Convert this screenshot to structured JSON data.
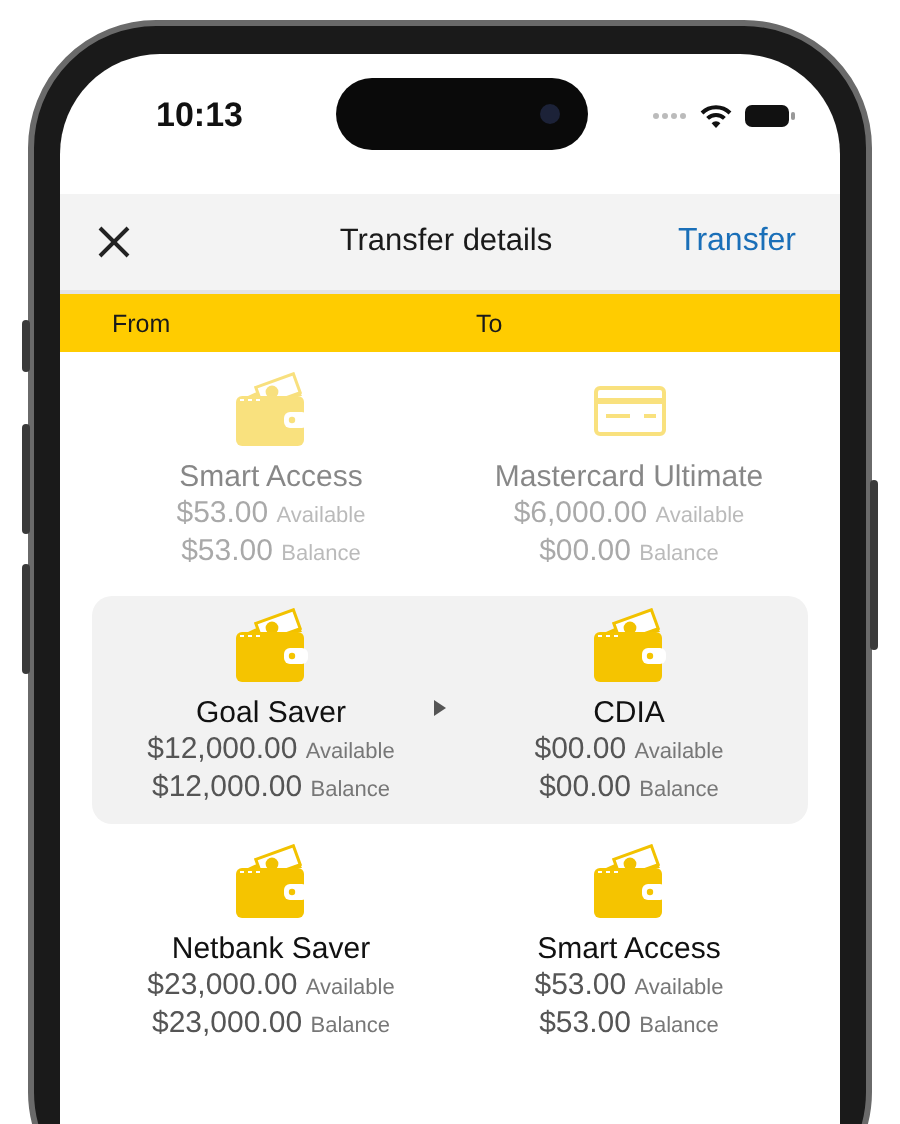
{
  "status_bar": {
    "time": "10:13"
  },
  "nav": {
    "title": "Transfer details",
    "action": "Transfer"
  },
  "columns": [
    "From",
    "To"
  ],
  "rows": [
    {
      "selected": false,
      "faded": true,
      "from": {
        "kind": "wallet",
        "name": "Smart Access",
        "available": "$53.00",
        "available_label": "Available",
        "balance": "$53.00",
        "balance_label": "Balance"
      },
      "to": {
        "kind": "card",
        "name": "Mastercard Ultimate",
        "available": "$6,000.00",
        "available_label": "Available",
        "balance": "$00.00",
        "balance_label": "Balance"
      }
    },
    {
      "selected": true,
      "faded": false,
      "from": {
        "kind": "wallet",
        "name": "Goal Saver",
        "available": "$12,000.00",
        "available_label": "Available",
        "balance": "$12,000.00",
        "balance_label": "Balance"
      },
      "to": {
        "kind": "wallet",
        "name": "CDIA",
        "available": "$00.00",
        "available_label": "Available",
        "balance": "$00.00",
        "balance_label": "Balance"
      }
    },
    {
      "selected": false,
      "faded": false,
      "from": {
        "kind": "wallet",
        "name": "Netbank Saver",
        "available": "$23,000.00",
        "available_label": "Available",
        "balance": "$23,000.00",
        "balance_label": "Balance"
      },
      "to": {
        "kind": "wallet",
        "name": "Smart Access",
        "available": "$53.00",
        "available_label": "Available",
        "balance": "$53.00",
        "balance_label": "Balance"
      }
    }
  ]
}
